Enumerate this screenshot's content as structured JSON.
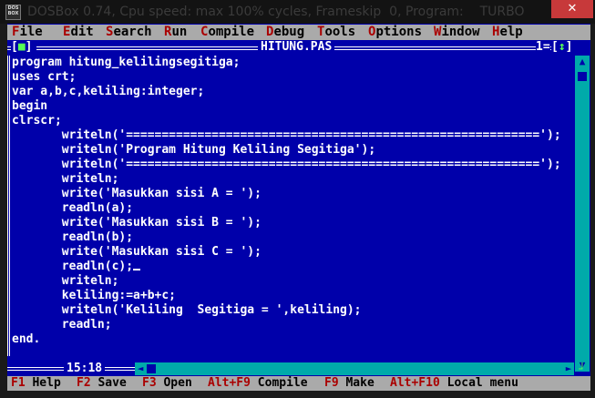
{
  "window": {
    "icon_text": "DOS BOX",
    "title": "DOSBox 0.74, Cpu speed: max 100% cycles, Frameskip  0, Program:    TURBO",
    "close_glyph": "✕"
  },
  "menu": [
    {
      "hot": "F",
      "rest": "ile"
    },
    {
      "hot": "E",
      "rest": "dit"
    },
    {
      "hot": "S",
      "rest": "earch"
    },
    {
      "hot": "R",
      "rest": "un"
    },
    {
      "hot": "C",
      "rest": "ompile"
    },
    {
      "hot": "D",
      "rest": "ebug"
    },
    {
      "hot": "T",
      "rest": "ools"
    },
    {
      "hot": "O",
      "rest": "ptions"
    },
    {
      "hot": "W",
      "rest": "indow"
    },
    {
      "hot": "H",
      "rest": "elp"
    }
  ],
  "editor": {
    "filename": "HITUNG.PAS",
    "close_box": "[■]",
    "window_number": "1=",
    "zoom_box": "[↕]",
    "position": "15:18",
    "lines": [
      "program hitung_kelilingsegitiga;",
      "uses crt;",
      "var a,b,c,keliling:integer;",
      "begin",
      "clrscr;",
      "       writeln('==========================================================');",
      "       writeln('Program Hitung Keliling Segitiga');",
      "       writeln('==========================================================');",
      "       writeln;",
      "       write('Masukkan sisi A = ');",
      "       readln(a);",
      "       write('Masukkan sisi B = ');",
      "       readln(b);",
      "       write('Masukkan sisi C = ');",
      "       readln(c);",
      "       writeln;",
      "       keliling:=a+b+c;",
      "       writeln('Keliling  Segitiga = ',keliling);",
      "       readln;",
      "end."
    ],
    "cursor_line": 14
  },
  "hints": [
    {
      "key": "F1",
      "label": " Help"
    },
    {
      "key": "F2",
      "label": " Save"
    },
    {
      "key": "F3",
      "label": " Open"
    },
    {
      "key": "Alt+F9",
      "label": " Compile"
    },
    {
      "key": "F9",
      "label": " Make"
    },
    {
      "key": "Alt+F10",
      "label": " Local menu"
    }
  ],
  "colors": {
    "editor_bg": "#0000aa",
    "menu_bg": "#aaaaaa",
    "hotkey": "#aa0000",
    "scrollbar": "#00aaaa",
    "close_button": "#c7393a"
  }
}
